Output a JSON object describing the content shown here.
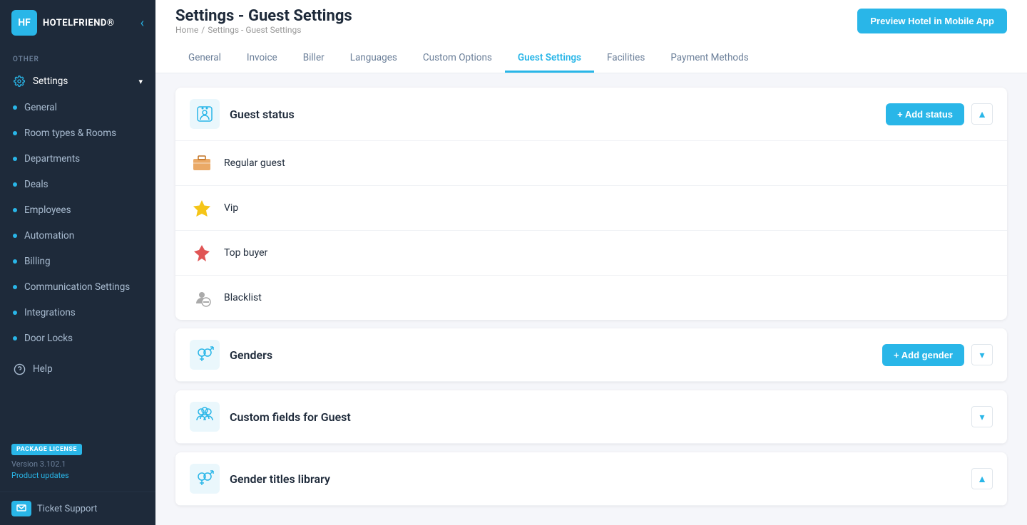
{
  "sidebar": {
    "logo": "HF",
    "brand": "HOTELFRIEND®",
    "section_label": "OTHER",
    "items": [
      {
        "id": "settings",
        "label": "Settings",
        "hasChevron": true,
        "active": true,
        "useIcon": true,
        "iconType": "gear"
      },
      {
        "id": "general",
        "label": "General",
        "hasDot": true
      },
      {
        "id": "room-types",
        "label": "Room types & Rooms",
        "hasDot": true
      },
      {
        "id": "departments",
        "label": "Departments",
        "hasDot": true
      },
      {
        "id": "deals",
        "label": "Deals",
        "hasDot": true
      },
      {
        "id": "employees",
        "label": "Employees",
        "hasDot": true
      },
      {
        "id": "automation",
        "label": "Automation",
        "hasDot": true
      },
      {
        "id": "billing",
        "label": "Billing",
        "hasDot": true
      },
      {
        "id": "communication-settings",
        "label": "Communication Settings",
        "hasDot": true
      },
      {
        "id": "integrations",
        "label": "Integrations",
        "hasDot": true
      },
      {
        "id": "door-locks",
        "label": "Door Locks",
        "hasDot": true
      }
    ],
    "help": {
      "label": "Help",
      "useIcon": true
    },
    "footer": {
      "badge": "PACKAGE LICENSE",
      "version": "Version 3.102.1",
      "product_updates": "Product updates"
    },
    "ticket_support": "Ticket Support"
  },
  "header": {
    "title": "Settings - Guest Settings",
    "breadcrumb": {
      "home": "Home",
      "separator": "/",
      "current": "Settings - Guest Settings"
    },
    "preview_btn": "Preview Hotel in Mobile App"
  },
  "tabs": [
    {
      "id": "general",
      "label": "General"
    },
    {
      "id": "invoice",
      "label": "Invoice"
    },
    {
      "id": "biller",
      "label": "Biller"
    },
    {
      "id": "languages",
      "label": "Languages"
    },
    {
      "id": "custom-options",
      "label": "Custom Options"
    },
    {
      "id": "guest-settings",
      "label": "Guest Settings",
      "active": true
    },
    {
      "id": "facilities",
      "label": "Facilities"
    },
    {
      "id": "payment-methods",
      "label": "Payment Methods"
    }
  ],
  "sections": [
    {
      "id": "guest-status",
      "title": "Guest status",
      "iconType": "guest-status",
      "addBtn": "+ Add status",
      "collapsed": false,
      "items": [
        {
          "id": "regular-guest",
          "name": "Regular guest",
          "iconType": "briefcase",
          "iconColor": "#e8a055"
        },
        {
          "id": "vip",
          "name": "Vip",
          "iconType": "star",
          "iconColor": "#f5c518"
        },
        {
          "id": "top-buyer",
          "name": "Top buyer",
          "iconType": "top-buyer",
          "iconColor": "#e05555"
        },
        {
          "id": "blacklist",
          "name": "Blacklist",
          "iconType": "blacklist",
          "iconColor": "#777"
        }
      ]
    },
    {
      "id": "genders",
      "title": "Genders",
      "iconType": "genders",
      "addBtn": "+ Add gender",
      "collapsed": false,
      "items": []
    },
    {
      "id": "custom-fields",
      "title": "Custom fields for Guest",
      "iconType": "custom-fields",
      "addBtn": null,
      "collapsed": true,
      "items": []
    },
    {
      "id": "gender-titles",
      "title": "Gender titles library",
      "iconType": "gender-titles",
      "addBtn": null,
      "collapsed": false,
      "items": []
    }
  ]
}
